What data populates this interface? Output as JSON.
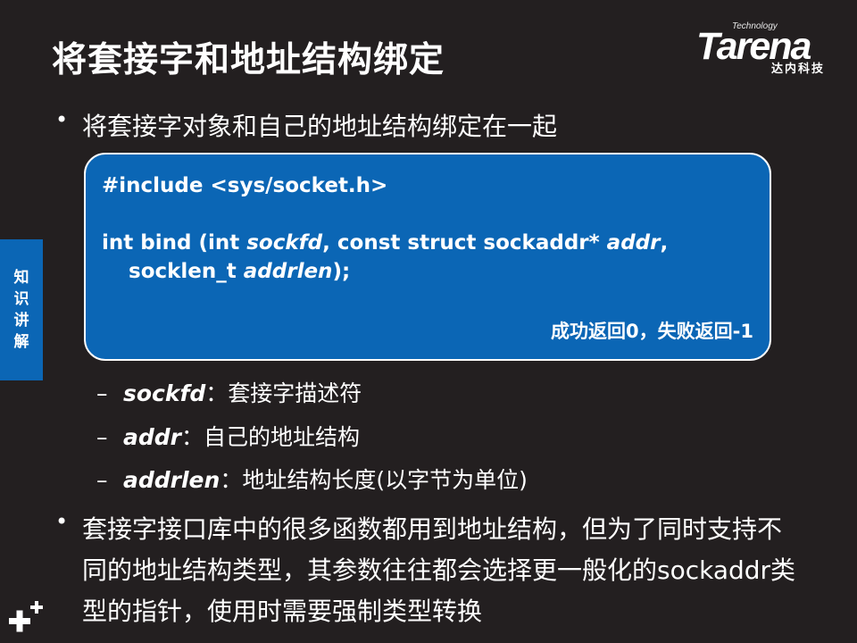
{
  "title": "将套接字和地址结构绑定",
  "logo": {
    "tech": "Technology",
    "brand": "Tarena",
    "sub": "达内科技"
  },
  "side_tab": [
    "知",
    "识",
    "讲",
    "解"
  ],
  "bullet1": "将套接字对象和自己的地址结构绑定在一起",
  "code": {
    "line1": "#include <sys/socket.h>",
    "line2_a": "int bind (int ",
    "line2_b": "sockfd",
    "line2_c": ", const struct sockaddr* ",
    "line2_d": "addr",
    "line2_e": ",",
    "line3_a": "socklen_t ",
    "line3_b": "addrlen",
    "line3_c": ");",
    "return": "成功返回0，失败返回-1"
  },
  "params": [
    {
      "dash": "–",
      "term": "sockfd",
      "desc": "：套接字描述符"
    },
    {
      "dash": "–",
      "term": "addr",
      "desc": "：自己的地址结构"
    },
    {
      "dash": "–",
      "term": "addrlen",
      "desc": "：地址结构长度(以字节为单位)"
    }
  ],
  "bullet2": "套接字接口库中的很多函数都用到地址结构，但为了同时支持不同的地址结构类型，其参数往往都会选择更一般化的sockaddr类型的指针，使用时需要强制类型转换",
  "bullet_symbol": "•"
}
